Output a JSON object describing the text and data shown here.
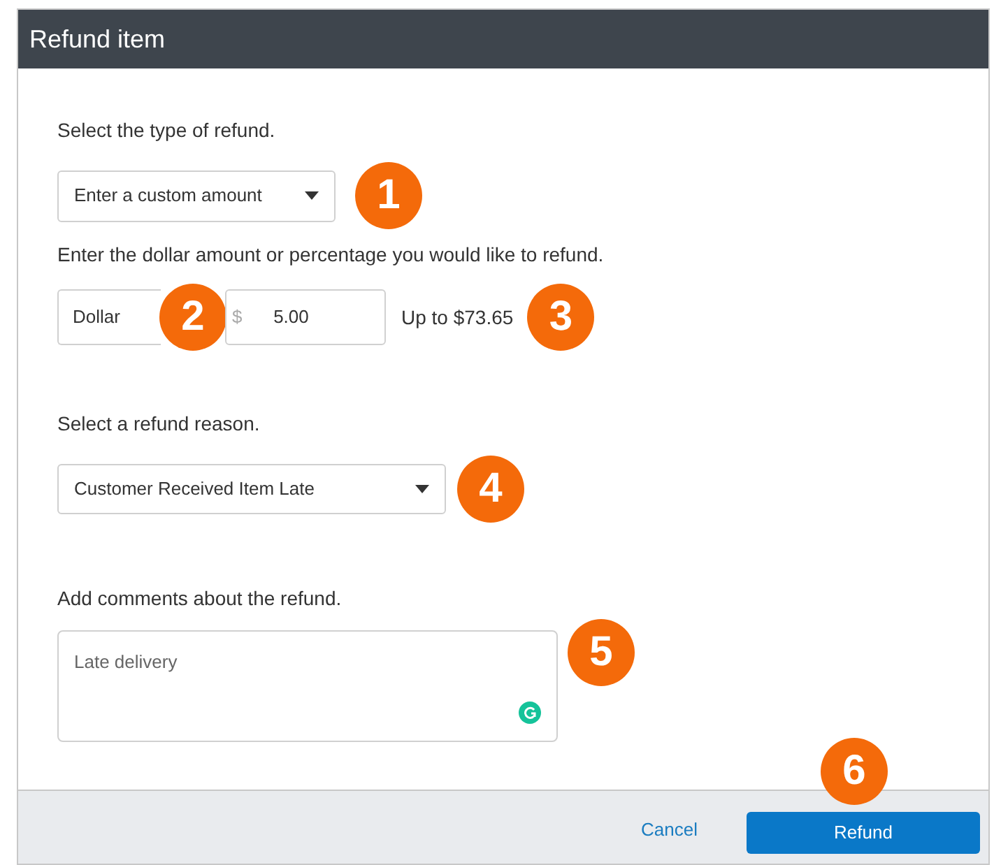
{
  "dialog": {
    "title": "Refund item"
  },
  "refund_type": {
    "label": "Select the type of refund.",
    "value": "Enter a custom amount",
    "callout": "1"
  },
  "amount": {
    "label": "Enter the dollar amount or percentage you would like to refund.",
    "unit": "Dollar",
    "unit_callout": "2",
    "currency": "$",
    "value": "5.00",
    "limit": "Up to $73.65",
    "callout": "3"
  },
  "reason": {
    "label": "Select a refund reason.",
    "value": "Customer Received Item Late",
    "callout": "4"
  },
  "comments": {
    "label": "Add comments about the refund.",
    "value": "Late delivery",
    "callout": "5"
  },
  "footer": {
    "cancel": "Cancel",
    "refund": "Refund",
    "callout": "6"
  }
}
